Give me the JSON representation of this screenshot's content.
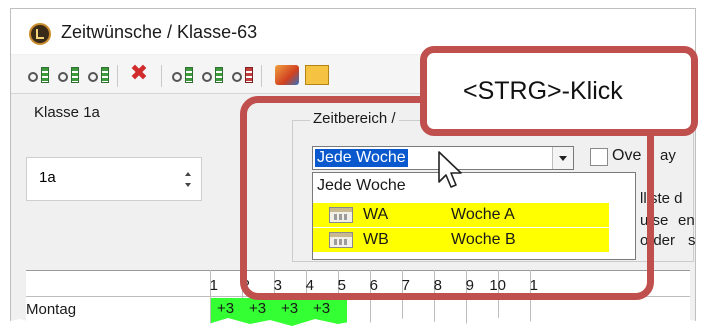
{
  "window": {
    "title": "Zeitwünsche / Klasse-63"
  },
  "toolbar": {
    "icons": [
      "green-stack-icon",
      "green-stack-icon",
      "green-stack-icon",
      "delete-icon",
      "key-stack-icon",
      "key-stack-icon",
      "red-stack-icon",
      "paint-icon",
      "report-icon"
    ],
    "delete_glyph": "✖"
  },
  "left": {
    "label": "Klasse 1a",
    "spinner_value": "1a"
  },
  "timerange": {
    "group_title": "Zeitbereich /",
    "selected": "Jede Woche",
    "checkbox_label": "Ove",
    "options": [
      {
        "code": "WA",
        "name": "Woche A",
        "highlight": "#ffff00"
      },
      {
        "code": "WB",
        "name": "Woche B",
        "highlight": "#ffff00"
      }
    ],
    "first_option": "Jede Woche",
    "side_text": [
      "ay",
      "lliste d",
      "u se",
      "en",
      "order",
      "s"
    ]
  },
  "callout": {
    "text": "<STRG>-Klick",
    "border_color": "#c0504d"
  },
  "grid": {
    "columns": [
      "1",
      "2",
      "3",
      "4",
      "5",
      "6",
      "7",
      "8",
      "9",
      "10",
      "1"
    ],
    "rows": [
      {
        "day": "Montag",
        "cells": [
          "+3",
          "+3",
          "+3",
          "+3"
        ]
      }
    ],
    "highlight_color": "#33ff33"
  }
}
